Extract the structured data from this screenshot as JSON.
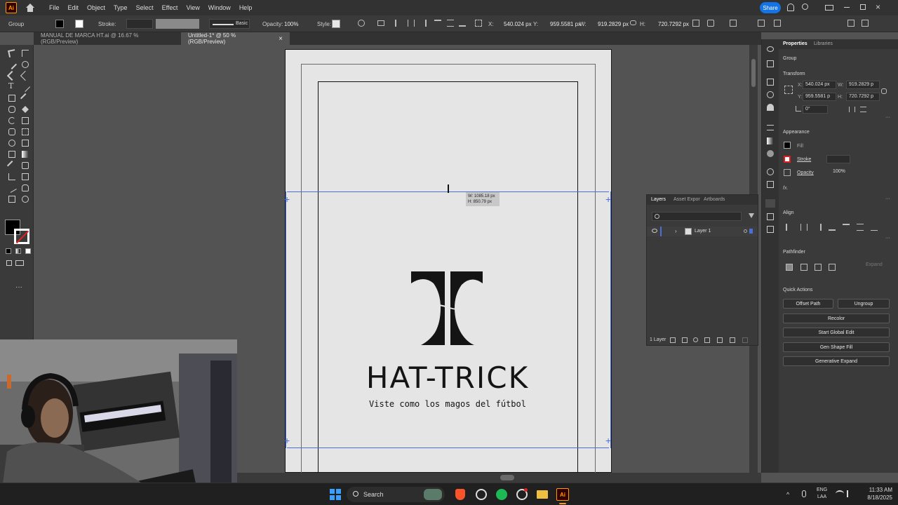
{
  "menubar": {
    "app_logo": "Ai",
    "items": [
      "File",
      "Edit",
      "Object",
      "Type",
      "Select",
      "Effect",
      "View",
      "Window",
      "Help"
    ],
    "share_label": "Share"
  },
  "controlbar": {
    "selection_type": "Group",
    "stroke_label": "Stroke:",
    "brush_label": "Basic",
    "opacity_label": "Opacity:",
    "opacity_value": "100%",
    "style_label": "Style:",
    "x_label": "X:",
    "x_value": "540.024 px",
    "y_label": "Y:",
    "y_value": "959.5581 px",
    "w_label": "W:",
    "w_value": "919.2829 px",
    "h_label": "H:",
    "h_value": "720.7292 px"
  },
  "tabs": [
    {
      "label": "MANUAL DE MARCA HT.ai @ 16.67 % (RGB/Preview)"
    },
    {
      "label": "Untitled-1* @ 50 % (RGB/Preview)",
      "close": "×"
    }
  ],
  "canvas": {
    "tooltip_w": "W: 1085.18 px",
    "tooltip_h": "H: 850.79 px",
    "logo_text": "HAT-TRICK",
    "tagline": "Viste como los magos del fútbol"
  },
  "properties": {
    "tab_properties": "Properties",
    "tab_libraries": "Libraries",
    "object_type": "Group",
    "transform_title": "Transform",
    "x_label": "X:",
    "x_value": "540.024 px",
    "y_label": "Y:",
    "y_value": "959.5581 p",
    "w_label": "W:",
    "w_value": "919.2829 p",
    "h_label": "H:",
    "h_value": "720.7292 p",
    "angle_value": "0°",
    "appearance_title": "Appearance",
    "fill_label": "Fill",
    "stroke_label": "Stroke",
    "opacity_label": "Opacity",
    "opacity_value": "100%",
    "fx_label": "fx.",
    "align_title": "Align",
    "pathfinder_title": "Pathfinder",
    "expand_label": "Expand",
    "quick_actions_title": "Quick Actions",
    "offset_path": "Offset Path",
    "ungroup": "Ungroup",
    "recolor": "Recolor",
    "start_global_edit": "Start Global Edit",
    "gen_shape_fill": "Gen Shape Fill",
    "generative_expand": "Generative Expand"
  },
  "layers": {
    "tab_layers": "Layers",
    "tab_asset": "Asset Expor",
    "tab_artboards": "Artboards",
    "layer_name": "Layer 1",
    "count": "1 Layer"
  },
  "taskbar": {
    "search_label": "Search",
    "lang": "ENG",
    "region": "LAA",
    "time": "11:33 AM",
    "date": "8/18/2025",
    "ai_icon_label": "Ai"
  },
  "colors": {
    "accent": "#1473e6",
    "selection": "#4a6fd8",
    "ai_orange": "#ff9a00"
  }
}
